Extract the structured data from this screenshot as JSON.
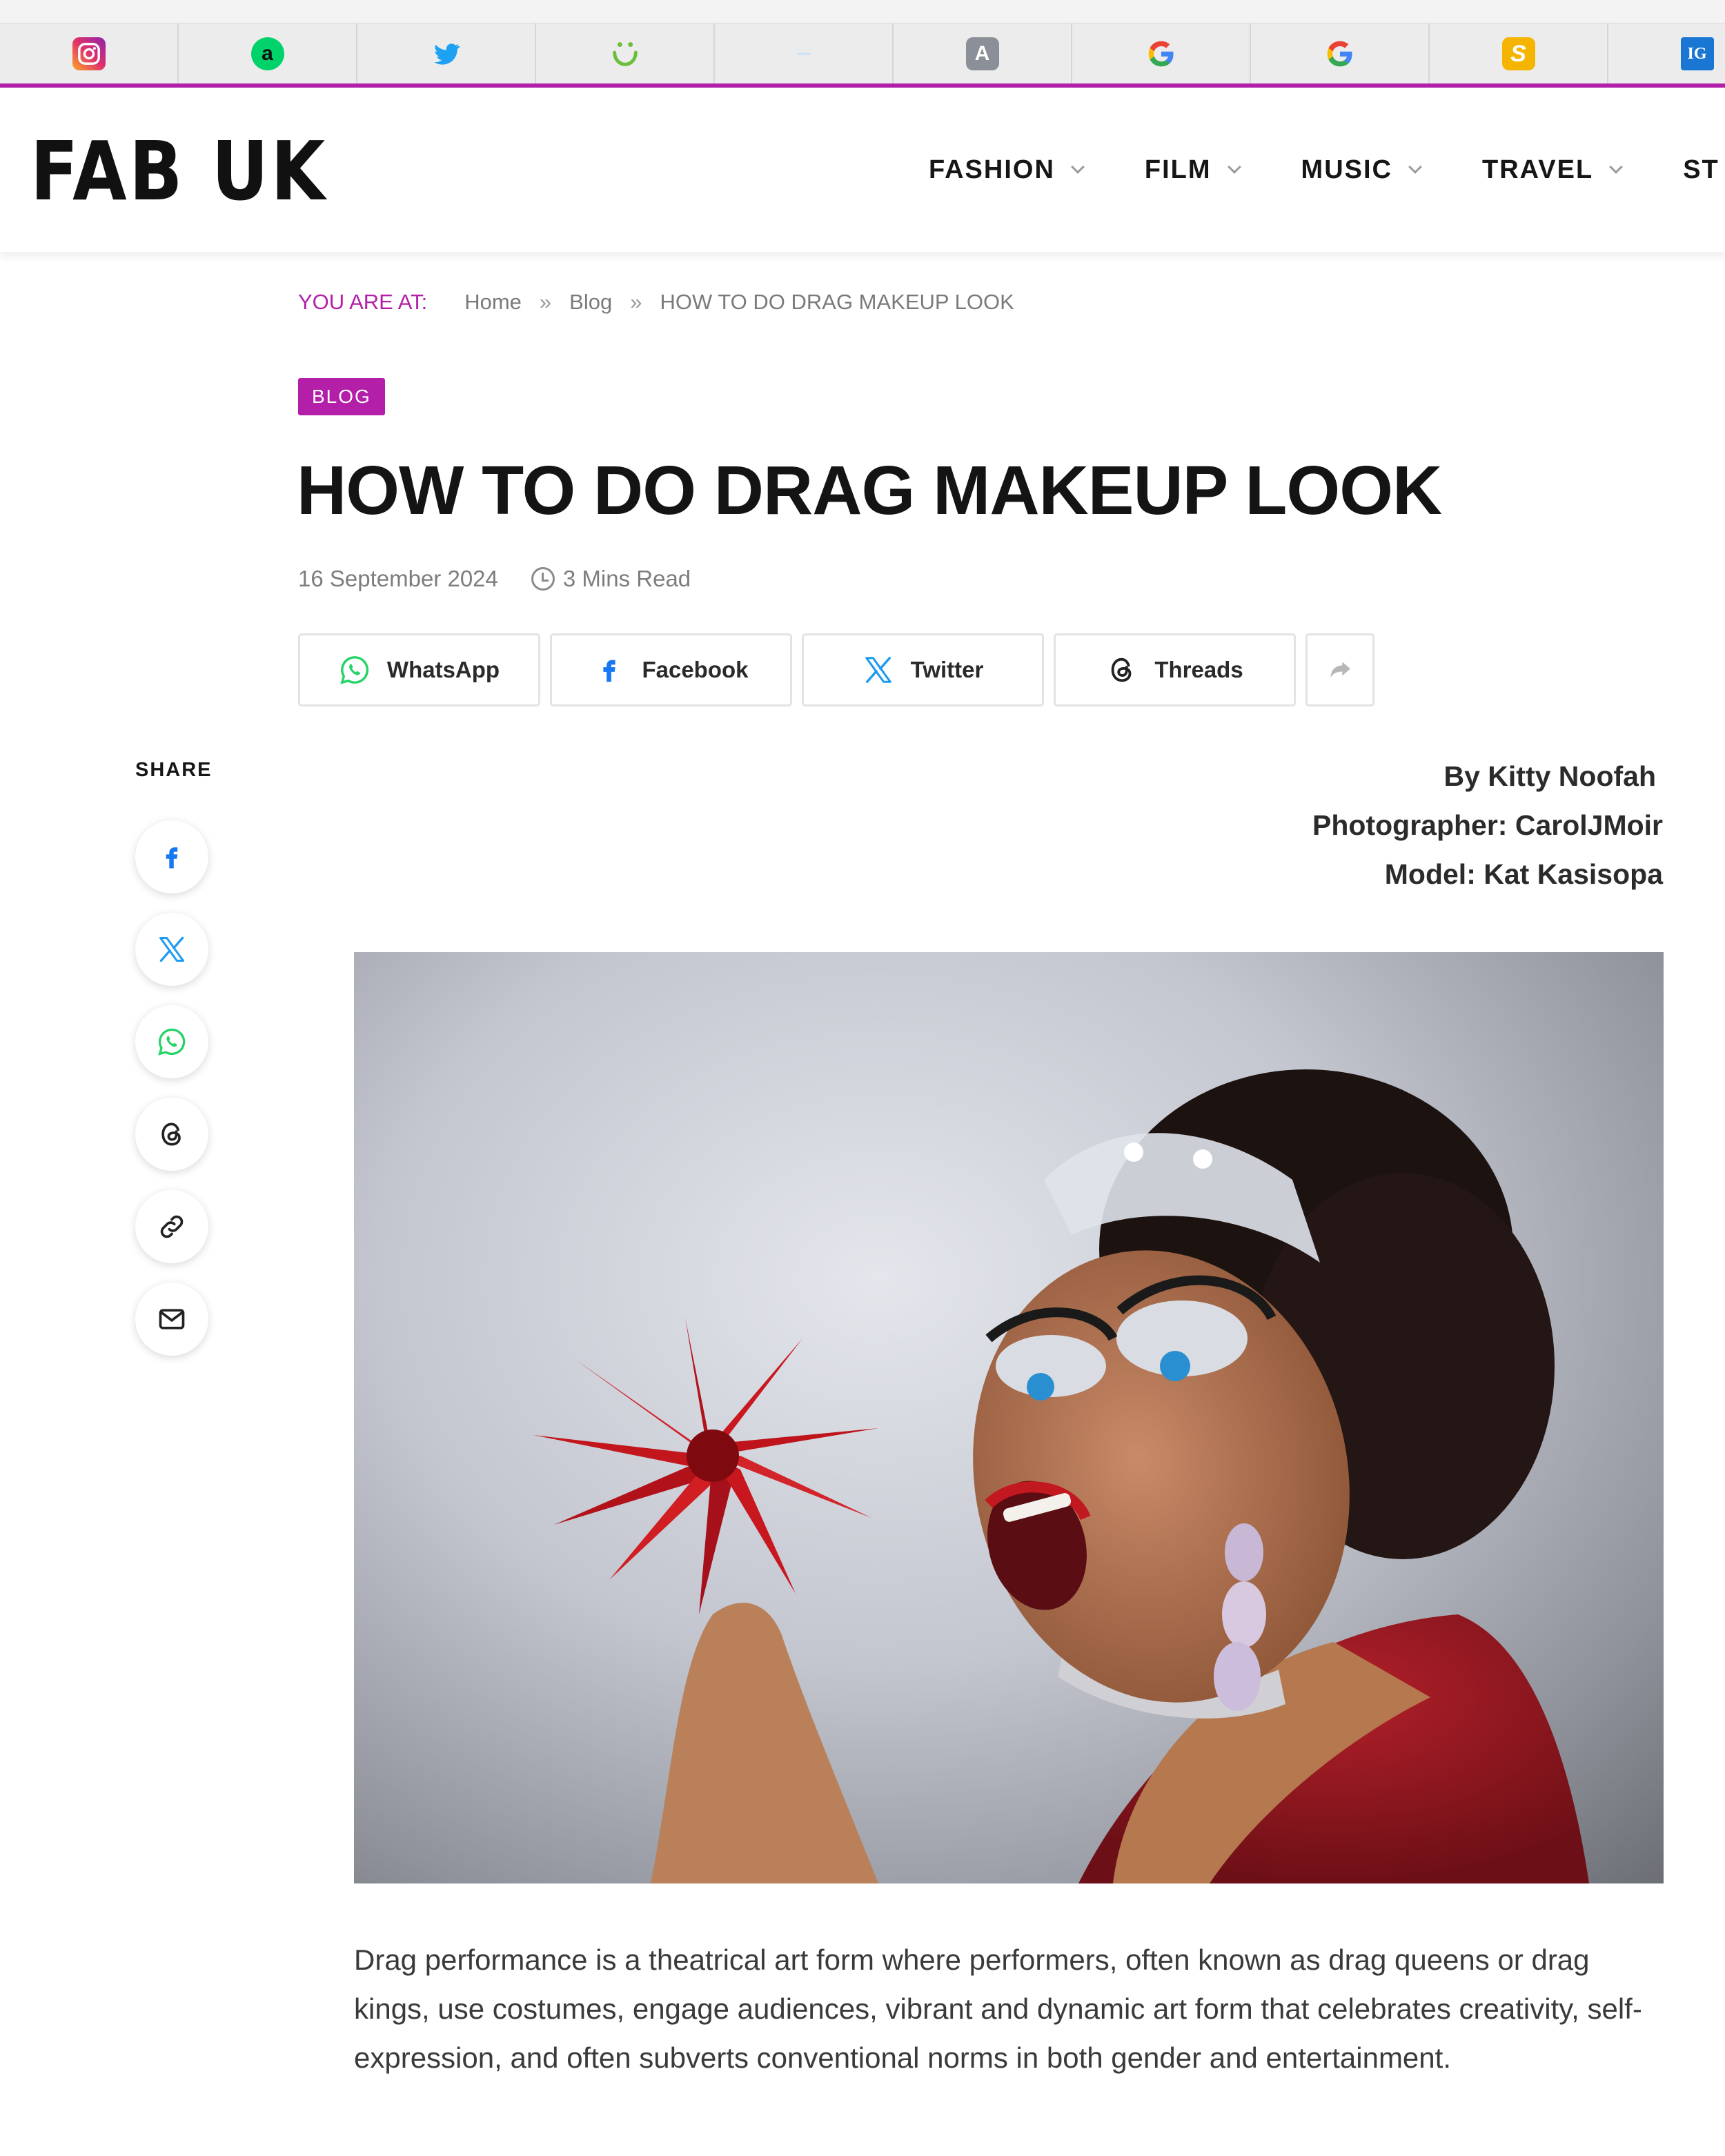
{
  "bookmarks": [
    {
      "icon": "instagram-icon",
      "glyph": "",
      "color": "#e1306c"
    },
    {
      "icon": "amazon-icon",
      "glyph": "a",
      "color": "#00c853"
    },
    {
      "icon": "twitter-icon",
      "glyph": "",
      "color": "#1da1f2"
    },
    {
      "icon": "smile-icon",
      "glyph": "",
      "color": "#6bbf3b"
    },
    {
      "icon": "blank-icon",
      "glyph": "",
      "color": "#d0e4f5"
    },
    {
      "icon": "a-icon",
      "glyph": "A",
      "color": "#8a8f98"
    },
    {
      "icon": "google-icon",
      "glyph": "G",
      "color": "#4285f4"
    },
    {
      "icon": "google-icon",
      "glyph": "G",
      "color": "#4285f4"
    },
    {
      "icon": "s-icon",
      "glyph": "S",
      "color": "#f5b400"
    },
    {
      "icon": "ig-icon",
      "glyph": "IG",
      "color": "#1976d2"
    }
  ],
  "site": {
    "logo": "FAB UK",
    "nav": [
      "FASHION",
      "FILM",
      "MUSIC",
      "TRAVEL",
      "ST"
    ],
    "accent": "#b31fa8"
  },
  "breadcrumb": {
    "label": "YOU ARE AT:",
    "home": "Home",
    "sep": "»",
    "blog": "Blog",
    "current": "HOW TO DO DRAG MAKEUP LOOK"
  },
  "article": {
    "category": "BLOG",
    "title": "HOW TO DO DRAG MAKEUP LOOK",
    "date": "16 September 2024",
    "read_time": "3 Mins Read",
    "credits": {
      "author": "By Kitty Noofah",
      "photographer": "Photographer: CarolJMoir",
      "model": "Model: Kat Kasisopa"
    },
    "intro": "Drag performance is a theatrical art form where performers, often known as drag queens or drag kings, use costumes, engage audiences, vibrant and dynamic art form that celebrates creativity, self-expression, and often subverts conventional norms in both gender and entertainment."
  },
  "share": {
    "buttons": [
      "WhatsApp",
      "Facebook",
      "Twitter",
      "Threads"
    ],
    "side_label": "SHARE",
    "side_icons": [
      "facebook-icon",
      "x-icon",
      "whatsapp-icon",
      "threads-icon",
      "link-icon",
      "mail-icon"
    ]
  }
}
